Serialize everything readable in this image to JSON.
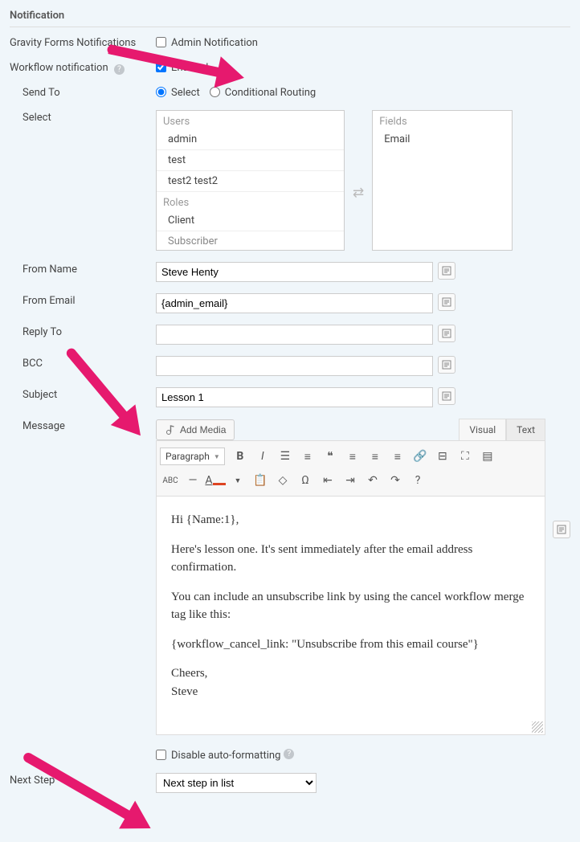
{
  "section": {
    "title": "Notification"
  },
  "gravity": {
    "label": "Gravity Forms Notifications",
    "checkbox": "Admin Notification"
  },
  "workflow": {
    "label": "Workflow notification",
    "checkbox": "Enabled"
  },
  "sendTo": {
    "label": "Send To",
    "options": {
      "select": "Select",
      "conditional": "Conditional Routing"
    }
  },
  "select": {
    "label": "Select",
    "left": {
      "usersHeader": "Users",
      "users": [
        "admin",
        "test",
        "test2 test2"
      ],
      "rolesHeader": "Roles",
      "roles": [
        "Client",
        "Subscriber"
      ]
    },
    "right": {
      "fieldsHeader": "Fields",
      "fields": [
        "Email"
      ]
    }
  },
  "fromName": {
    "label": "From Name",
    "value": "Steve Henty"
  },
  "fromEmail": {
    "label": "From Email",
    "value": "{admin_email}"
  },
  "replyTo": {
    "label": "Reply To",
    "value": ""
  },
  "bcc": {
    "label": "BCC",
    "value": ""
  },
  "subject": {
    "label": "Subject",
    "value": "Lesson 1"
  },
  "message": {
    "label": "Message",
    "addMedia": "Add Media",
    "tabs": {
      "visual": "Visual",
      "text": "Text"
    },
    "paragraphSelect": "Paragraph",
    "body": {
      "p1": "Hi {Name:1},",
      "p2": "Here's lesson one. It's sent immediately after the email address confirmation.",
      "p3": "You can include an unsubscribe link by using the cancel workflow merge tag like this:",
      "p4": "{workflow_cancel_link: \"Unsubscribe from this email course\"}",
      "p5a": "Cheers,",
      "p5b": "Steve"
    }
  },
  "disableAuto": {
    "label": "Disable auto-formatting"
  },
  "nextStep": {
    "label": "Next Step",
    "value": "Next step in list"
  }
}
